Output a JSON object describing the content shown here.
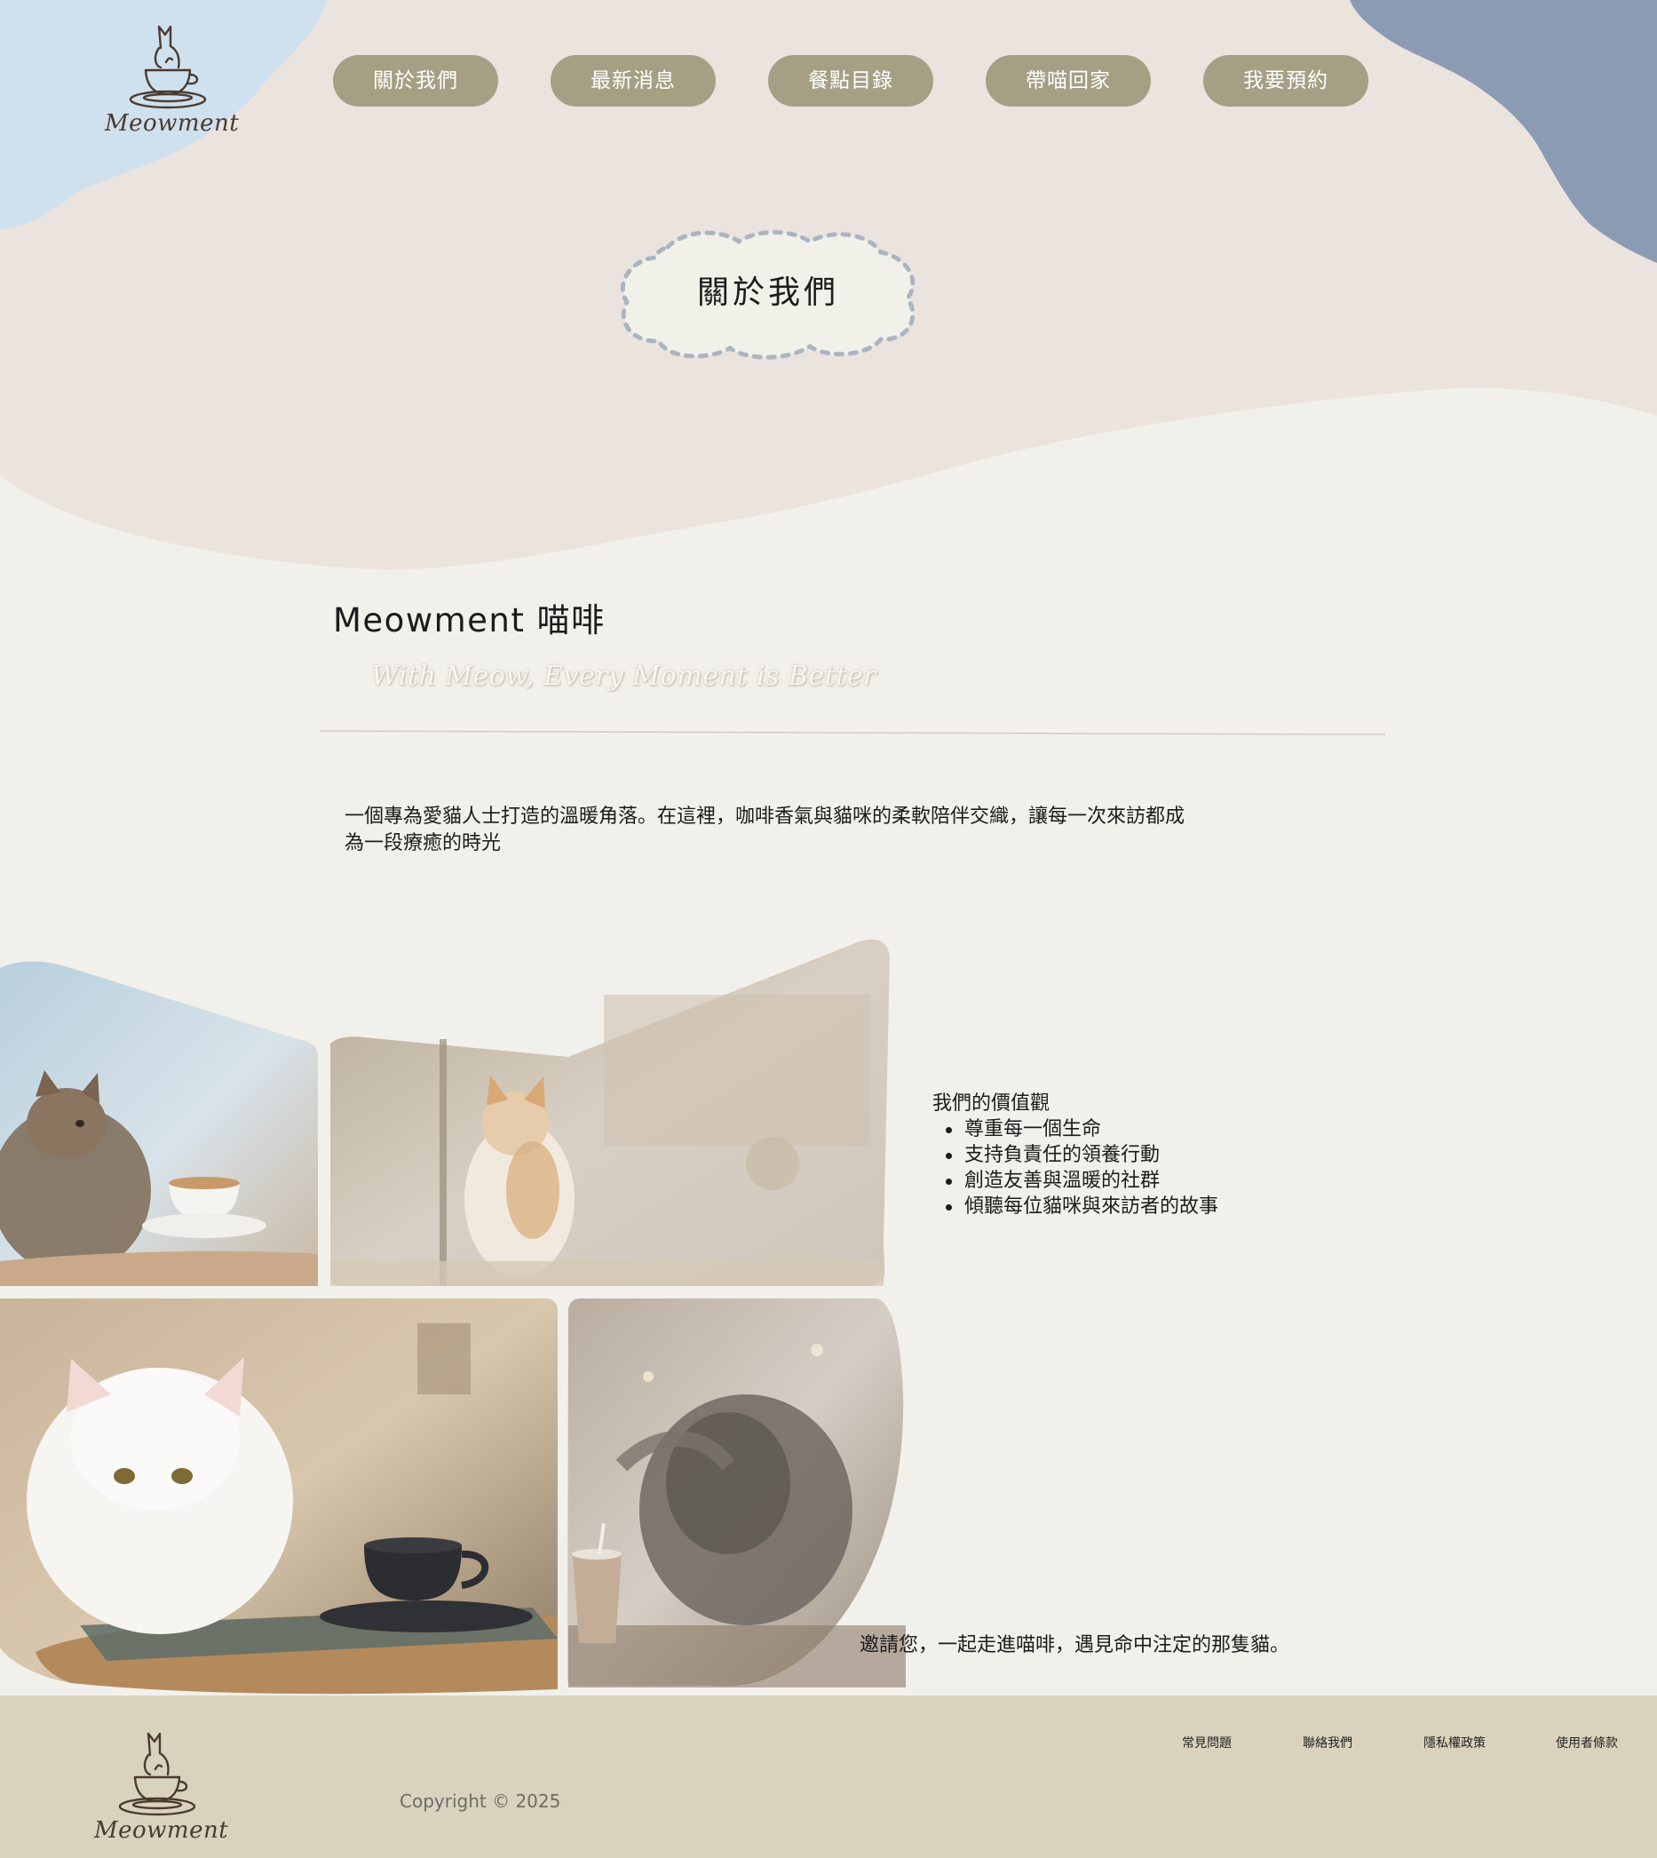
{
  "brand": {
    "logo_text": "Meowment"
  },
  "nav": {
    "items": [
      {
        "label": "關於我們"
      },
      {
        "label": "最新消息"
      },
      {
        "label": "餐點目錄"
      },
      {
        "label": "帶喵回家"
      },
      {
        "label": "我要預約"
      }
    ]
  },
  "page": {
    "title": "關於我們"
  },
  "about": {
    "brand_title": "Meowment 喵啡",
    "tagline": "With Meow, Every Moment is Better",
    "intro": "一個專為愛貓人士打造的溫暖角落。在這裡，咖啡香氣與貓咪的柔軟陪伴交織，讓每一次來訪都成為一段療癒的時光"
  },
  "values": {
    "heading": "我們的價值觀",
    "items": [
      "尊重每一個生命",
      "支持負責任的領養行動",
      "創造友善與溫暖的社群",
      "傾聽每位貓咪與來訪者的故事"
    ]
  },
  "invite": "邀請您，一起走進喵啡，遇見命中注定的那隻貓。",
  "footer": {
    "links": [
      "常見問題",
      "聯絡我們",
      "隱私權政策",
      "使用者條款"
    ],
    "copyright": "Copyright © 2025"
  },
  "colors": {
    "page_bg": "#f2f0ea",
    "header_bg": "#ebe3de",
    "blob_light_blue": "#cfe0ee",
    "blob_slate_blue": "#8a9bb3",
    "nav_button": "#a59f84",
    "footer_bg": "#d9d3bd",
    "logo_brown": "#4a3a2e"
  }
}
